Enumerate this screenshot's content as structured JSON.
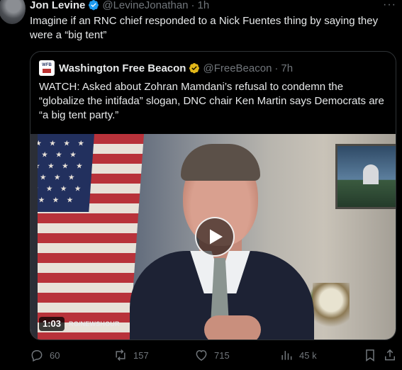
{
  "author": {
    "name": "Jon Levine",
    "handle": "@LevineJonathan",
    "separator": "·",
    "time": "1h",
    "more_label": "···"
  },
  "tweet": {
    "text": "Imagine if an RNC chief responded to a Nick Fuentes thing by saying they were a “big tent”"
  },
  "quoted": {
    "logo_text": "WFB",
    "name": "Washington Free Beacon",
    "handle": "@FreeBeacon",
    "separator": "·",
    "time": "7h",
    "text": "WATCH: Asked about Zohran Mamdani’s refusal to condemn the “globalize the intifada” slogan, DNC chair Ken Martin says Democrats are “a big tent party.”",
    "video": {
      "duration": "1:03",
      "source": "RG/NEWSHOUR"
    }
  },
  "actions": {
    "replies": "60",
    "reposts": "157",
    "likes": "715",
    "views": "45 k"
  },
  "colors": {
    "background": "#000000",
    "text": "#e7e9ea",
    "muted": "#71767b",
    "verified_blue": "#1d9bf0",
    "verified_gold": "#e2b719",
    "border": "#2f3336"
  }
}
